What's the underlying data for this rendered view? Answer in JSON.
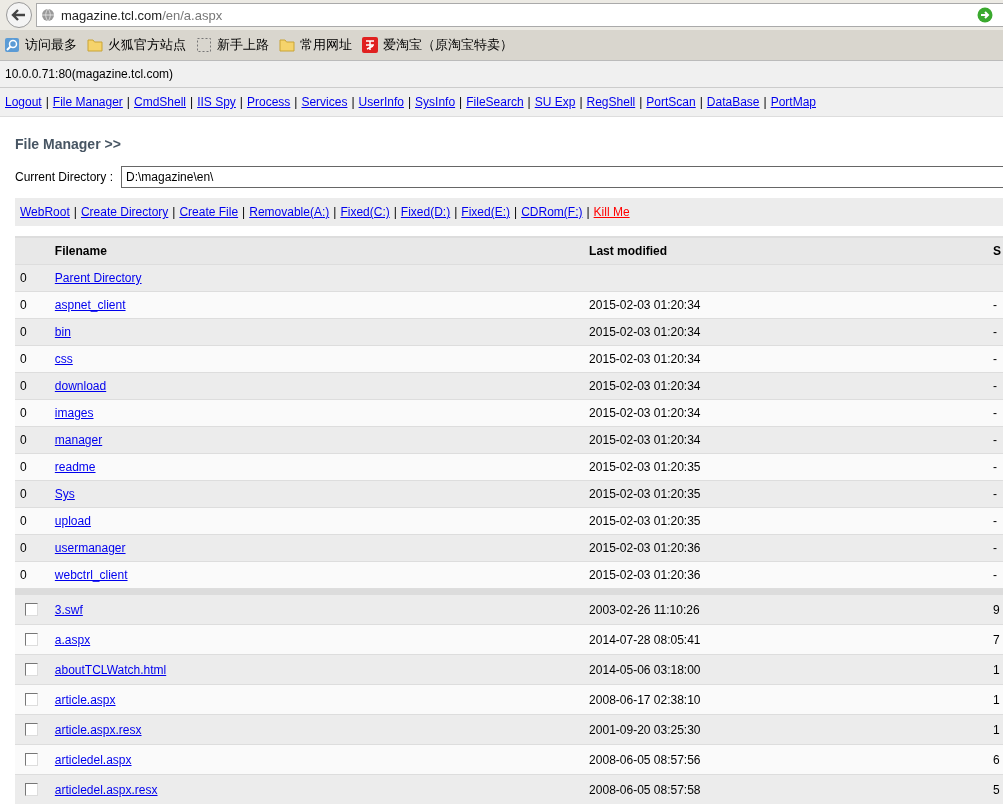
{
  "browser": {
    "url_host": "magazine.tcl.com",
    "url_path": "/en/a.aspx",
    "bookmarks": [
      {
        "label": "访问最多",
        "kind": "search"
      },
      {
        "label": "火狐官方站点",
        "kind": "folder"
      },
      {
        "label": "新手上路",
        "kind": "blank"
      },
      {
        "label": "常用网址",
        "kind": "folder"
      },
      {
        "label": "爱淘宝（原淘宝特卖）",
        "kind": "taobao"
      }
    ]
  },
  "link_separator": "|",
  "host_line": "10.0.0.71:80(magazine.tcl.com)",
  "nav_links": [
    "Logout",
    "File Manager",
    "CmdShell",
    "IIS Spy",
    "Process",
    "Services",
    "UserInfo",
    "SysInfo",
    "FileSearch",
    "SU Exp",
    "RegShell",
    "PortScan",
    "DataBase",
    "PortMap"
  ],
  "section_title": "File Manager >>",
  "directory": {
    "label": "Current Directory :",
    "value": "D:\\magazine\\en\\"
  },
  "actions": [
    {
      "label": "WebRoot",
      "kind": "link"
    },
    {
      "label": "Create Directory",
      "kind": "link"
    },
    {
      "label": "Create File",
      "kind": "link"
    },
    {
      "label": "Removable(A:)",
      "kind": "link"
    },
    {
      "label": "Fixed(C:)",
      "kind": "link"
    },
    {
      "label": "Fixed(D:)",
      "kind": "link"
    },
    {
      "label": "Fixed(E:)",
      "kind": "link"
    },
    {
      "label": "CDRom(F:)",
      "kind": "link"
    },
    {
      "label": "Kill Me",
      "kind": "danger"
    }
  ],
  "table": {
    "columns": [
      "Filename",
      "Last modified",
      "S"
    ],
    "directories": [
      {
        "mark": "0",
        "name": "Parent Directory"
      },
      {
        "mark": "0",
        "name": "aspnet_client",
        "modified": "2015-02-03 01:20:34",
        "size": "-"
      },
      {
        "mark": "0",
        "name": "bin",
        "modified": "2015-02-03 01:20:34",
        "size": "-"
      },
      {
        "mark": "0",
        "name": "css",
        "modified": "2015-02-03 01:20:34",
        "size": "-"
      },
      {
        "mark": "0",
        "name": "download",
        "modified": "2015-02-03 01:20:34",
        "size": "-"
      },
      {
        "mark": "0",
        "name": "images",
        "modified": "2015-02-03 01:20:34",
        "size": "-"
      },
      {
        "mark": "0",
        "name": "manager",
        "modified": "2015-02-03 01:20:34",
        "size": "-"
      },
      {
        "mark": "0",
        "name": "readme",
        "modified": "2015-02-03 01:20:35",
        "size": "-"
      },
      {
        "mark": "0",
        "name": "Sys",
        "modified": "2015-02-03 01:20:35",
        "size": "-"
      },
      {
        "mark": "0",
        "name": "upload",
        "modified": "2015-02-03 01:20:35",
        "size": "-"
      },
      {
        "mark": "0",
        "name": "usermanager",
        "modified": "2015-02-03 01:20:36",
        "size": "-"
      },
      {
        "mark": "0",
        "name": "webctrl_client",
        "modified": "2015-02-03 01:20:36",
        "size": "-"
      }
    ],
    "files": [
      {
        "checked": false,
        "name": "3.swf",
        "modified": "2003-02-26 11:10:26",
        "size": "9"
      },
      {
        "checked": false,
        "name": "a.aspx",
        "modified": "2014-07-28 08:05:41",
        "size": "7"
      },
      {
        "checked": false,
        "name": "aboutTCLWatch.html",
        "modified": "2014-05-06 03:18:00",
        "size": "1"
      },
      {
        "checked": false,
        "name": "article.aspx",
        "modified": "2008-06-17 02:38:10",
        "size": "1"
      },
      {
        "checked": false,
        "name": "article.aspx.resx",
        "modified": "2001-09-20 03:25:30",
        "size": "1"
      },
      {
        "checked": false,
        "name": "articledel.aspx",
        "modified": "2008-06-05 08:57:56",
        "size": "6"
      },
      {
        "checked": false,
        "name": "articledel.aspx.resx",
        "modified": "2008-06-05 08:57:58",
        "size": "5"
      }
    ]
  }
}
